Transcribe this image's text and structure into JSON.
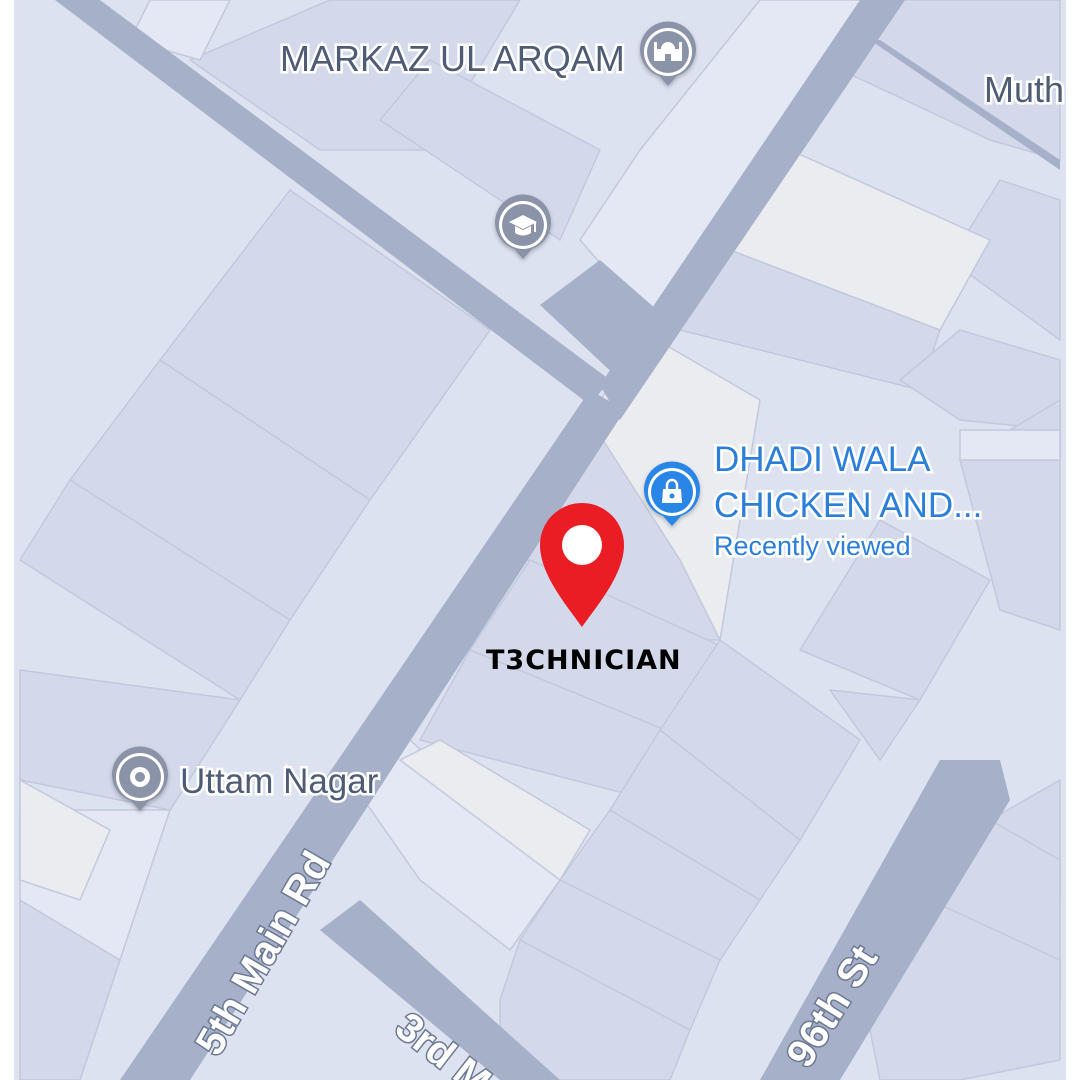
{
  "map": {
    "colors": {
      "land": "#dde2f1",
      "block": "#d3d9ea",
      "block_light": "#e4e8f4",
      "block_beige": "#ebecef",
      "block_edge": "#c2c9dc",
      "road": "#a6b1c9",
      "poi_gray": "#8a93a8",
      "poi_blue": "#2b86e6",
      "poi_label_gray": "#4f5c75",
      "poi_label_blue": "#2b7fd9",
      "pin_red": "#ea1c24",
      "marker_text": "#000000",
      "road_label_fill": "#ffffff",
      "road_label_stroke": "#6d7893"
    },
    "places": [
      {
        "id": "markaz",
        "name": "MARKAZ UL ARQAM",
        "icon": "mosque-icon"
      },
      {
        "id": "school",
        "name": "",
        "icon": "graduation-cap-icon"
      },
      {
        "id": "muth",
        "name": "Muth"
      },
      {
        "id": "dhadi",
        "name_line1": "DHADI WALA",
        "name_line2": "CHICKEN AND...",
        "note": "Recently viewed",
        "icon": "shopping-bag-icon"
      },
      {
        "id": "uttam",
        "name": "Uttam Nagar",
        "icon": "locality-dot-icon"
      }
    ],
    "roads": {
      "main": "5th Main Rd",
      "third": "3rd M",
      "ninety_sixth": "96th St"
    },
    "marker": {
      "label": "T3CHNICIAN",
      "icon": "location-pin-icon"
    }
  }
}
